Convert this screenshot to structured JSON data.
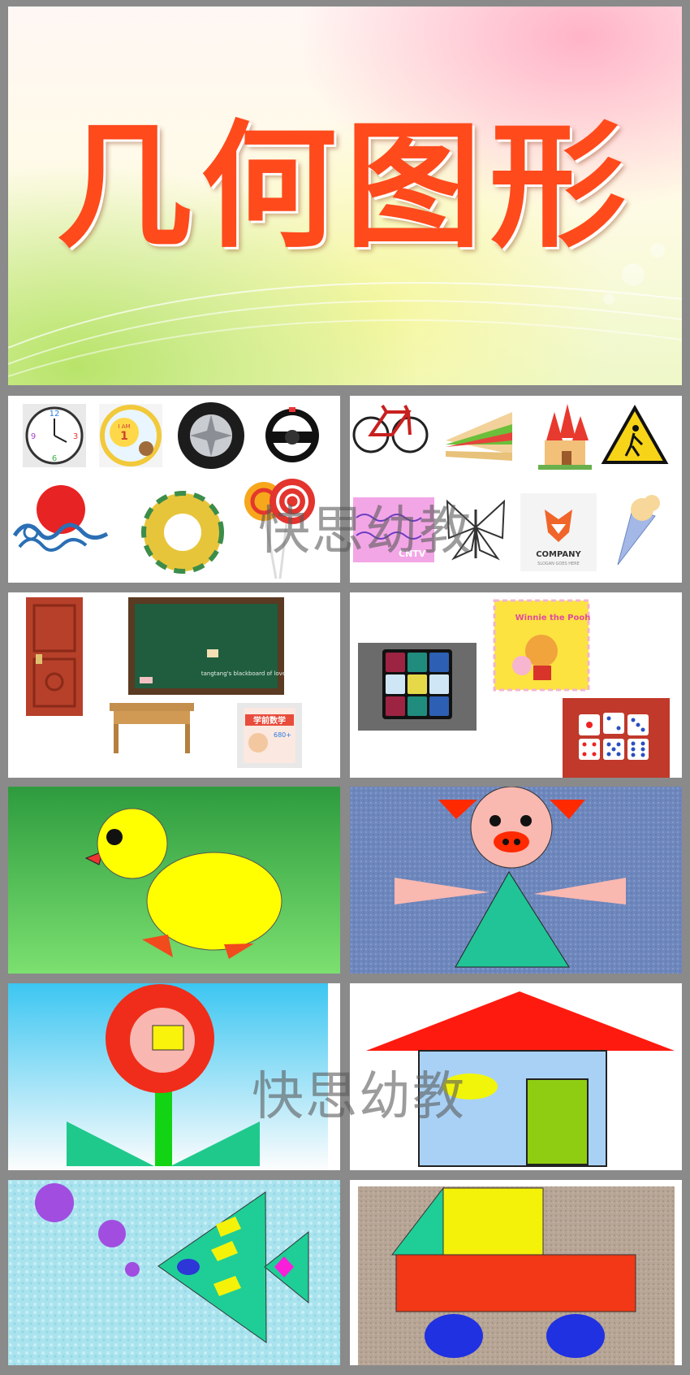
{
  "title": "几何图形",
  "watermark": "快思幼教",
  "labels": {
    "clock_numbers": [
      "12",
      "3",
      "6",
      "9"
    ],
    "plate_text": "I AM",
    "plate_number": "1",
    "chalkboard_caption": "tangtang's blackboard of love",
    "book_title": "学前数学",
    "book_subtitle": "680+",
    "tv_logo": "CNTV",
    "company_logo": "COMPANY",
    "company_tagline": "SLOGAN GOES HERE",
    "towel_text": "Winnie the Pooh"
  }
}
